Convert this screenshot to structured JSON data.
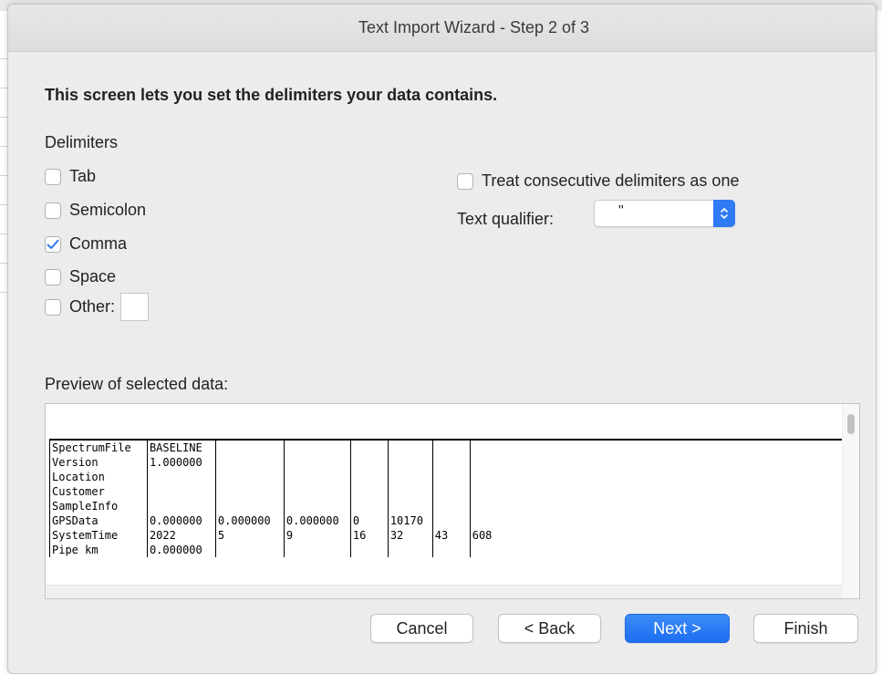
{
  "window": {
    "title": "Text Import Wizard - Step 2 of 3"
  },
  "heading": "This screen lets you set the delimiters your data contains.",
  "delimiters": {
    "label": "Delimiters",
    "options": [
      {
        "label": "Tab",
        "checked": false
      },
      {
        "label": "Semicolon",
        "checked": false
      },
      {
        "label": "Comma",
        "checked": true
      },
      {
        "label": "Space",
        "checked": false
      },
      {
        "label": "Other:",
        "checked": false,
        "value": ""
      }
    ]
  },
  "consecutive": {
    "label": "Treat consecutive delimiters as one",
    "checked": false
  },
  "text_qualifier": {
    "label": "Text qualifier:",
    "value": "\""
  },
  "preview": {
    "label": "Preview of selected data:",
    "rows": [
      [
        "SpectrumFile",
        "BASELINE",
        "",
        "",
        "",
        "",
        "",
        ""
      ],
      [
        "Version",
        "1.000000",
        "",
        "",
        "",
        "",
        "",
        ""
      ],
      [
        "Location",
        "",
        "",
        "",
        "",
        "",
        "",
        ""
      ],
      [
        "Customer",
        "",
        "",
        "",
        "",
        "",
        "",
        ""
      ],
      [
        "SampleInfo",
        "",
        "",
        "",
        "",
        "",
        "",
        ""
      ],
      [
        "GPSData",
        "0.000000",
        "0.000000",
        "0.000000",
        "0",
        "10170",
        "",
        ""
      ],
      [
        "SystemTime",
        "2022",
        "5",
        "9",
        "16",
        "32",
        "43",
        "608"
      ],
      [
        "Pipe km",
        "0.000000",
        "",
        "",
        "",
        "",
        "",
        ""
      ]
    ]
  },
  "buttons": {
    "cancel": "Cancel",
    "back": "< Back",
    "next": "Next >",
    "finish": "Finish"
  },
  "colors": {
    "accent": "#2f7bf5",
    "window_bg": "#ececec"
  }
}
